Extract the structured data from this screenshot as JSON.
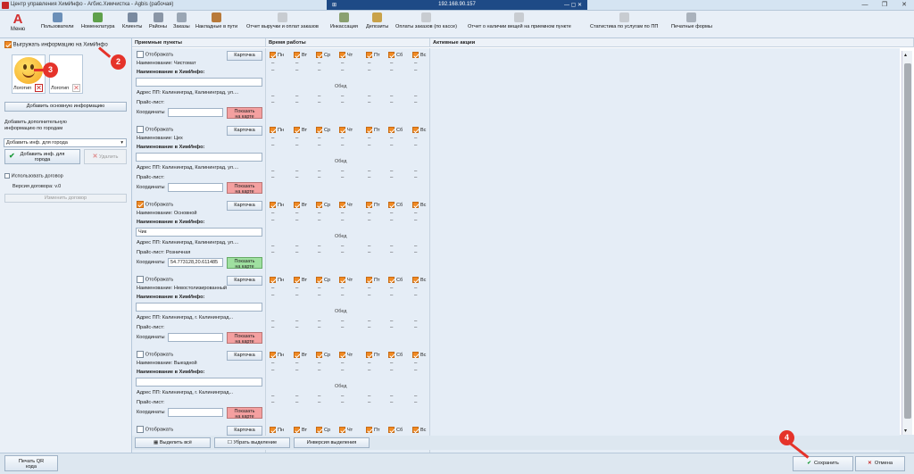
{
  "window": {
    "title": "Центр управления ХимИнфо - Агбис.Химчистка - Agbis (рабочая)",
    "remote_ip": "192.168.90.157"
  },
  "toolbar": {
    "menu_label": "Меню",
    "items": [
      "Пользователи",
      "Номенклатура",
      "Клиенты",
      "Районы",
      "Заказы",
      "Накладные в пути",
      "Отчет выручки и оплат заказов",
      "Инкассация",
      "Депозиты",
      "Оплаты заказов (по кассе)",
      "Отчет о наличии вещей на приемном пункте",
      "Статистика по услугам по ПП",
      "Печатные формы"
    ]
  },
  "left": {
    "export_label": "Выгружать информацию на ХимИнфо",
    "logo1": "Логотип",
    "logo2": "Логотип",
    "add_main_info": "Добавить основную информацию",
    "add_city_info_text_1": "Добавить дополнительную",
    "add_city_info_text_2": "информацию по городам",
    "city_select": "Добавить инф. для города",
    "add_city_btn_1": "Добавить инф. для",
    "add_city_btn_2": "города",
    "delete_btn": "Удалить",
    "use_contract": "Использовать договор",
    "contract_version": "Версия договора: v.0",
    "change_contract": "Изменить договор"
  },
  "markers": {
    "m2": "2",
    "m3": "3",
    "m4": "4"
  },
  "columns": {
    "points": "Приемные пункты",
    "hours": "Время работы",
    "promos": "Активные акции"
  },
  "labels": {
    "show": "Отображать",
    "card": "Карточка",
    "name_prefix": "Наименование: ",
    "name_himinfo": "Наименование в ХимИнфо:",
    "address_prefix": "Адрес ПП: ",
    "price_prefix": "Прайс-лист: ",
    "coords": "Координаты",
    "show_on_map_1": "Показать",
    "show_on_map_2": "на карте",
    "lunch": "Обед",
    "dash": "–"
  },
  "days": [
    "Пн",
    "Вт",
    "Ср",
    "Чт",
    "Пт",
    "Сб",
    "Вс"
  ],
  "cards": [
    {
      "show": false,
      "name": "Чистомат",
      "himinfo": "",
      "address": "Калининград, Калининград, ул....",
      "price": "",
      "coords": "",
      "map_ok": false
    },
    {
      "show": false,
      "name": "Цех",
      "himinfo": "",
      "address": "Калининград, Калининград, ул....",
      "price": "",
      "coords": "",
      "map_ok": false
    },
    {
      "show": true,
      "name": "Основной",
      "himinfo": "Чик",
      "address": "Калининград, Калининград, ул....",
      "price": "Розничная",
      "coords": "54.773128,20.611485",
      "map_ok": true
    },
    {
      "show": false,
      "name": "Невостолизированный",
      "himinfo": "",
      "address": "Калининград, г. Калининград...",
      "price": "",
      "coords": "",
      "map_ok": false
    },
    {
      "show": false,
      "name": "Выездной",
      "himinfo": "",
      "address": "Калининград, г. Калининград...",
      "price": "",
      "coords": "",
      "map_ok": false
    },
    {
      "show": false,
      "name": "",
      "himinfo": "",
      "address": "",
      "price": "",
      "coords": "",
      "map_ok": false
    }
  ],
  "bottom": {
    "select_all": "Выделить всё",
    "deselect": "Убрать выделение",
    "invert": "Инверсия выделения"
  },
  "footer": {
    "print_qr_1": "Печать QR",
    "print_qr_2": "кода",
    "save": "Сохранить",
    "cancel": "Отмена"
  },
  "colors": {
    "accent": "#f08a24",
    "marker": "#e5332a",
    "map_red": "#f4a0a0",
    "map_green": "#9fe0a0"
  }
}
